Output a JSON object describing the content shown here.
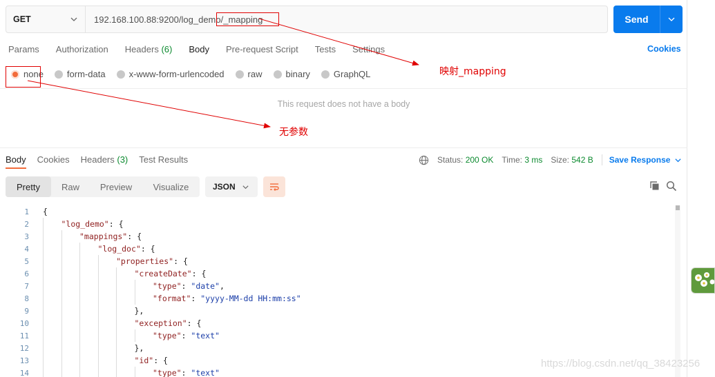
{
  "request": {
    "method": "GET",
    "url": "192.168.100.88:9200/log_demo/_mapping",
    "send_label": "Send"
  },
  "request_tabs": [
    {
      "label": "Params"
    },
    {
      "label": "Authorization"
    },
    {
      "label": "Headers",
      "count": "(6)"
    },
    {
      "label": "Body"
    },
    {
      "label": "Pre-request Script"
    },
    {
      "label": "Tests"
    },
    {
      "label": "Settings"
    }
  ],
  "cookies_label": "Cookies",
  "body_types": [
    {
      "label": "none",
      "selected": true
    },
    {
      "label": "form-data"
    },
    {
      "label": "x-www-form-urlencoded"
    },
    {
      "label": "raw"
    },
    {
      "label": "binary"
    },
    {
      "label": "GraphQL"
    }
  ],
  "no_body_text": "This request does not have a body",
  "response_tabs": [
    {
      "label": "Body"
    },
    {
      "label": "Cookies"
    },
    {
      "label": "Headers",
      "count": "(3)"
    },
    {
      "label": "Test Results"
    }
  ],
  "status": {
    "status_label": "Status:",
    "status_value": "200 OK",
    "time_label": "Time:",
    "time_value": "3 ms",
    "size_label": "Size:",
    "size_value": "542 B",
    "save_label": "Save Response"
  },
  "view_modes": [
    "Pretty",
    "Raw",
    "Preview",
    "Visualize"
  ],
  "format_label": "JSON",
  "code_lines": [
    {
      "n": "1",
      "depth": 0,
      "parts": [
        [
          "p",
          "{"
        ]
      ]
    },
    {
      "n": "2",
      "depth": 1,
      "parts": [
        [
          "k",
          "\"log_demo\""
        ],
        [
          "p",
          ": {"
        ]
      ]
    },
    {
      "n": "3",
      "depth": 2,
      "parts": [
        [
          "k",
          "\"mappings\""
        ],
        [
          "p",
          ": {"
        ]
      ]
    },
    {
      "n": "4",
      "depth": 3,
      "parts": [
        [
          "k",
          "\"log_doc\""
        ],
        [
          "p",
          ": {"
        ]
      ]
    },
    {
      "n": "5",
      "depth": 4,
      "parts": [
        [
          "k",
          "\"properties\""
        ],
        [
          "p",
          ": {"
        ]
      ]
    },
    {
      "n": "6",
      "depth": 5,
      "parts": [
        [
          "k",
          "\"createDate\""
        ],
        [
          "p",
          ": {"
        ]
      ]
    },
    {
      "n": "7",
      "depth": 6,
      "parts": [
        [
          "k",
          "\"type\""
        ],
        [
          "p",
          ": "
        ],
        [
          "s",
          "\"date\""
        ],
        [
          "p",
          ","
        ]
      ]
    },
    {
      "n": "8",
      "depth": 6,
      "parts": [
        [
          "k",
          "\"format\""
        ],
        [
          "p",
          ": "
        ],
        [
          "s",
          "\"yyyy-MM-dd HH:mm:ss\""
        ]
      ]
    },
    {
      "n": "9",
      "depth": 5,
      "parts": [
        [
          "p",
          "},"
        ]
      ]
    },
    {
      "n": "10",
      "depth": 5,
      "parts": [
        [
          "k",
          "\"exception\""
        ],
        [
          "p",
          ": {"
        ]
      ]
    },
    {
      "n": "11",
      "depth": 6,
      "parts": [
        [
          "k",
          "\"type\""
        ],
        [
          "p",
          ": "
        ],
        [
          "s",
          "\"text\""
        ]
      ]
    },
    {
      "n": "12",
      "depth": 5,
      "parts": [
        [
          "p",
          "},"
        ]
      ]
    },
    {
      "n": "13",
      "depth": 5,
      "parts": [
        [
          "k",
          "\"id\""
        ],
        [
          "p",
          ": {"
        ]
      ]
    },
    {
      "n": "14",
      "depth": 6,
      "parts": [
        [
          "k",
          "\"type\""
        ],
        [
          "p",
          ": "
        ],
        [
          "s",
          "\"text\""
        ]
      ]
    }
  ],
  "annotations": {
    "mapping_note": "映射_mapping",
    "no_param_note": "无参数"
  },
  "watermark": "https://blog.csdn.net/qq_38423256",
  "colors": {
    "accent": "#097bed",
    "selected_radio": "#f26b3a",
    "status_ok": "#0c8a2f",
    "annotation_red": "#e00000"
  }
}
